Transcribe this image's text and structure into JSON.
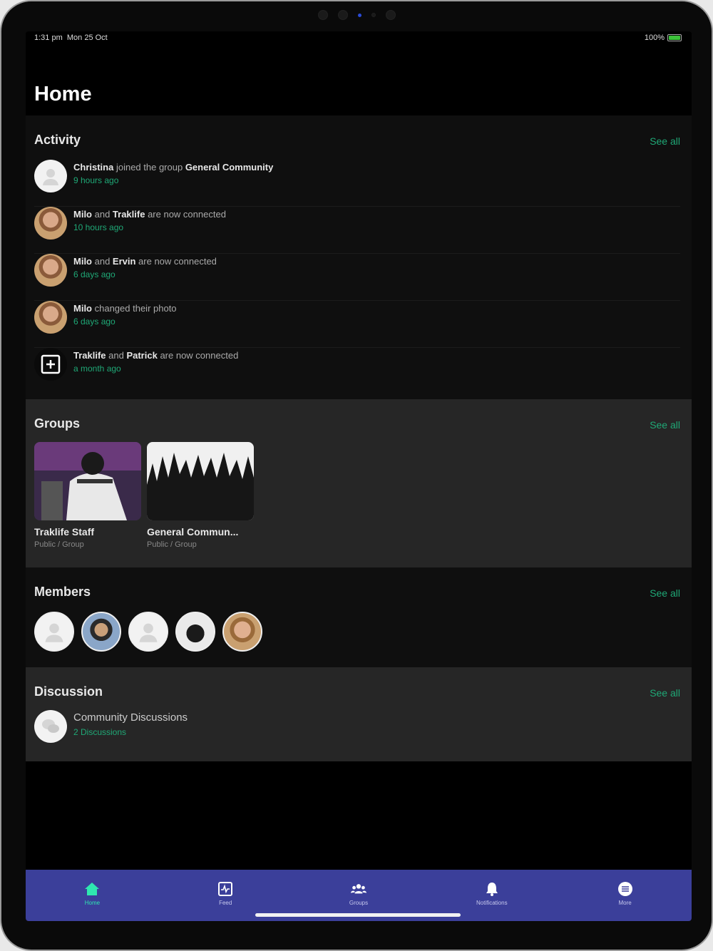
{
  "status": {
    "time": "1:31 pm",
    "date": "Mon 25 Oct",
    "battery": "100%"
  },
  "header": {
    "title": "Home"
  },
  "activity": {
    "title": "Activity",
    "see_all": "See all",
    "items": [
      {
        "actor": "Christina",
        "verb": " joined the group ",
        "target": "General Community",
        "tail": "",
        "time": "9 hours ago",
        "avatar": "blank-avatar"
      },
      {
        "actor": "Milo",
        "verb": " and ",
        "target": "Traklife",
        "tail": " are now connected",
        "time": "10 hours ago",
        "avatar": "photo"
      },
      {
        "actor": "Milo",
        "verb": " and ",
        "target": "Ervin",
        "tail": " are now connected",
        "time": "6 days ago",
        "avatar": "photo"
      },
      {
        "actor": "Milo",
        "verb": " changed their photo",
        "target": "",
        "tail": "",
        "time": "6 days ago",
        "avatar": "photo"
      },
      {
        "actor": "Traklife",
        "verb": " and ",
        "target": "Patrick",
        "tail": " are now connected",
        "time": "a month ago",
        "avatar": "plus-square-icon"
      }
    ]
  },
  "groups": {
    "title": "Groups",
    "see_all": "See all",
    "items": [
      {
        "name": "Traklife Staff",
        "meta": "Public / Group"
      },
      {
        "name": "General Commun...",
        "meta": "Public / Group"
      }
    ]
  },
  "members": {
    "title": "Members",
    "see_all": "See all"
  },
  "discussion": {
    "title": "Discussion",
    "see_all": "See all",
    "item_title": "Community Discussions",
    "item_count": "2 Discussions"
  },
  "tabs": [
    {
      "label": "Home",
      "icon": "home-icon",
      "active": true
    },
    {
      "label": "Feed",
      "icon": "feed-icon",
      "active": false
    },
    {
      "label": "Groups",
      "icon": "groups-icon",
      "active": false
    },
    {
      "label": "Notifications",
      "icon": "bell-icon",
      "active": false
    },
    {
      "label": "More",
      "icon": "menu-icon",
      "active": false
    }
  ],
  "colors": {
    "accent": "#1fa876",
    "tab_bg": "#3b3f9a",
    "active_tab": "#2fe7b0"
  }
}
